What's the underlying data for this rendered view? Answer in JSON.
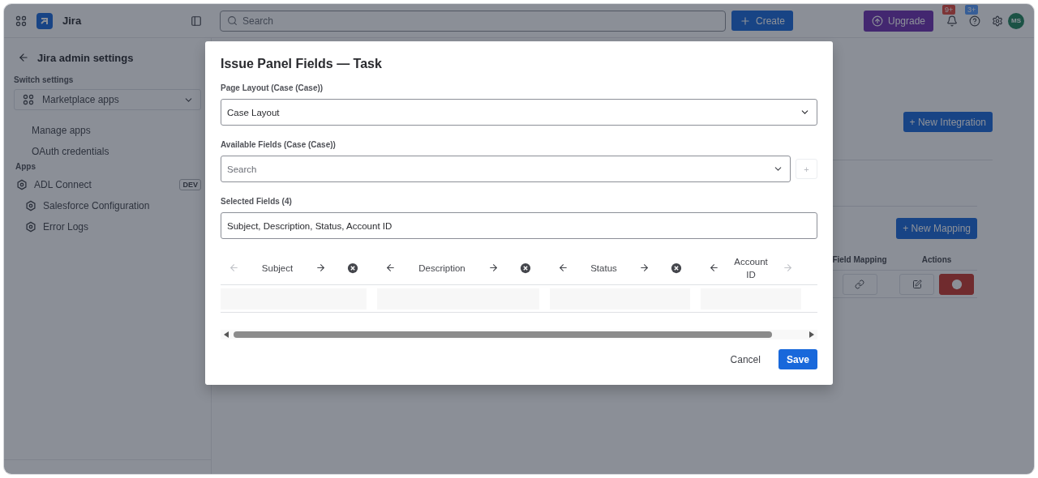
{
  "app": {
    "name": "Jira"
  },
  "top_bar": {
    "search": {
      "placeholder": "Search"
    },
    "create_button": "Create",
    "upgrade_button": "Upgrade",
    "notifications_badge": "9+",
    "help_badge": "3+",
    "avatar": "MS"
  },
  "sidebar": {
    "title": "Jira admin settings",
    "switch_label": "Switch settings",
    "switch_value": "Marketplace apps",
    "items": [
      {
        "label": "Manage apps"
      },
      {
        "label": "OAuth credentials"
      }
    ],
    "section": "Apps",
    "apps": [
      {
        "label": "ADL Connect",
        "badge": "DEV",
        "children": [
          {
            "label": "Salesforce Configuration"
          },
          {
            "label": "Error Logs"
          }
        ]
      }
    ]
  },
  "main": {
    "new_integration_button": "+ New Integration",
    "new_mapping_button": "+ New Mapping",
    "table": {
      "columns": [
        "Field Mapping",
        "Actions"
      ]
    }
  },
  "modal": {
    "title": "Issue Panel Fields — Task",
    "page_layout": {
      "label": "Page Layout (Case (Case))",
      "value": "Case Layout"
    },
    "available": {
      "label": "Available Fields (Case (Case))",
      "placeholder": "Search",
      "add_button": "+",
      "disabled": true
    },
    "selected": {
      "label": "Selected Fields (4)",
      "value": "Subject, Description, Status, Account ID"
    },
    "columns": [
      {
        "name": "Subject",
        "can_move_left": false,
        "can_move_right": true,
        "remove_shown": true
      },
      {
        "name": "Description",
        "can_move_left": true,
        "can_move_right": true,
        "remove_shown": true
      },
      {
        "name": "Status",
        "can_move_left": true,
        "can_move_right": true,
        "remove_shown": true
      },
      {
        "name": "Account ID",
        "can_move_left": true,
        "can_move_right": false,
        "remove_shown": false
      }
    ],
    "buttons": {
      "cancel": "Cancel",
      "save": "Save"
    }
  }
}
